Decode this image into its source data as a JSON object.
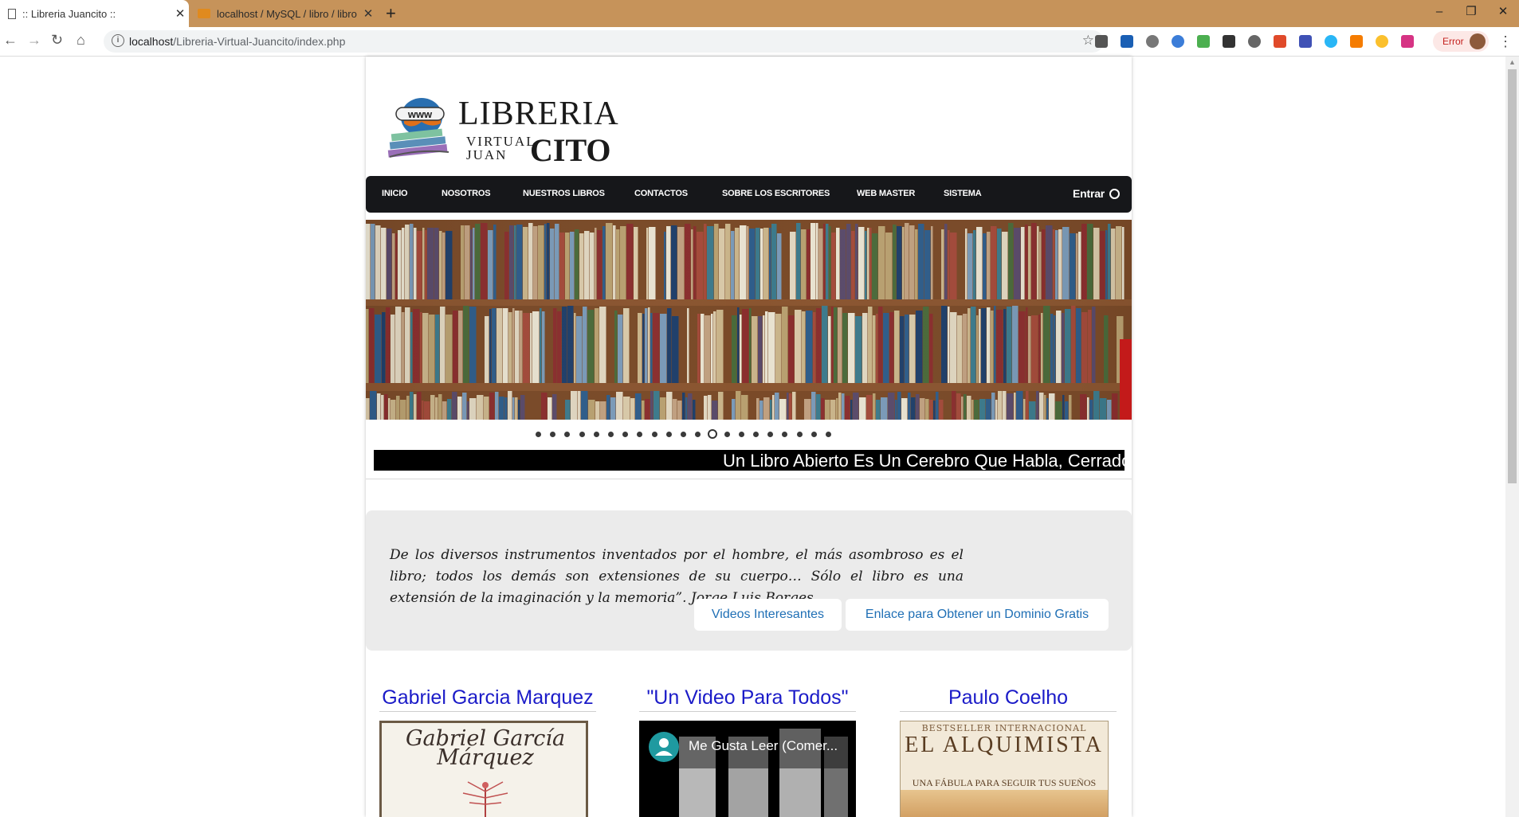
{
  "browser": {
    "tabs": [
      {
        "title": ":: Libreria Juancito ::",
        "active": true
      },
      {
        "title": "localhost / MySQL / libro / libro",
        "active": false
      }
    ],
    "new_tab_label": "+",
    "url_host": "localhost",
    "url_path": "/Libreria-Virtual-Juancito/index.php",
    "error_label": "Error",
    "window_buttons": {
      "minimize": "–",
      "restore": "❐",
      "close": "✕"
    }
  },
  "site": {
    "logo": {
      "line1": "LIBRERIA",
      "line2a": "VIRTUAL",
      "line2b": "JUAN",
      "line3": "CITO",
      "badge": "www"
    },
    "menu": [
      "INICIO",
      "NOSOTROS",
      "NUESTROS LIBROS",
      "CONTACTOS",
      "SOBRE LOS ESCRITORES",
      "WEB MASTER",
      "SISTEMA"
    ],
    "login_label": "Entrar",
    "slider": {
      "dot_count": 21,
      "active_index": 12
    },
    "marquee_text": "Un Libro Abierto Es Un Cerebro Que Habla, Cerrado",
    "quote": "De los diversos instrumentos inventados por el hombre, el más asombroso es el libro; todos los demás son extensiones de su cuerpo… Sólo el libro es una extensión de la imaginación y la memoria”. Jorge Luis Borges.",
    "buttons": [
      "Videos Interesantes",
      "Enlace para Obtener un Dominio Gratis"
    ],
    "columns": [
      {
        "title": "Gabriel Garcia Marquez",
        "image_text": "Gabriel García Márquez"
      },
      {
        "title": "\"Un Video Para Todos\"",
        "video_title": "Me Gusta Leer (Comer..."
      },
      {
        "title": "Paulo Coelho",
        "image_top": "BESTSELLER INTERNACIONAL",
        "image_title": "EL ALQUIMISTA",
        "image_sub": "UNA FÁBULA PARA SEGUIR TUS SUEÑOS"
      }
    ]
  },
  "colors": {
    "tabstrip": "#c6935a",
    "menu_bg": "#16171a",
    "column_title": "#1b1bc8",
    "button_text": "#1f6fb5",
    "quote_bg": "#ebebeb"
  }
}
